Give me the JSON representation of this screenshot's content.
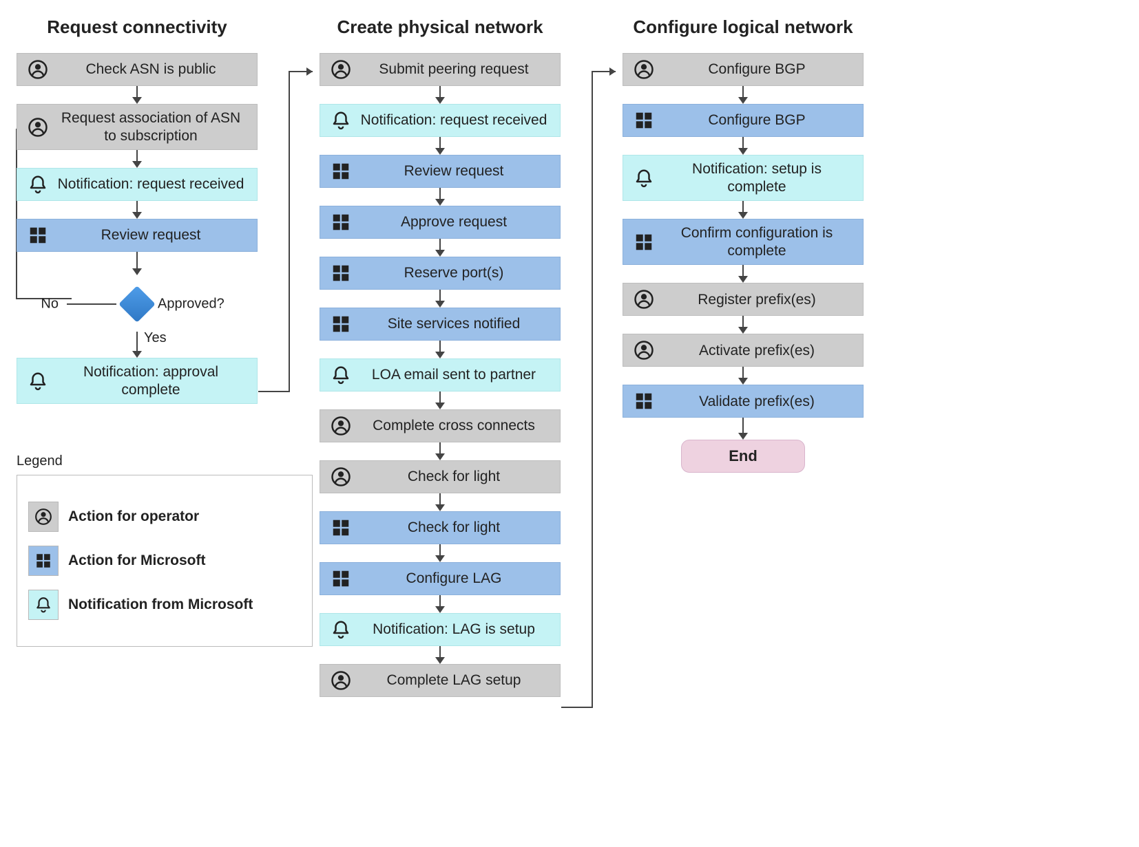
{
  "columns": {
    "c1": {
      "title": "Request connectivity",
      "steps": [
        {
          "label": "Check ASN is public"
        },
        {
          "label": "Request association of ASN to subscription"
        },
        {
          "label": "Notification: request received"
        },
        {
          "label": "Review request"
        },
        {
          "label": "Notification: approval complete"
        }
      ],
      "decision": {
        "no": "No",
        "yes": "Yes",
        "question": "Approved?"
      }
    },
    "c2": {
      "title": "Create physical network",
      "steps": [
        {
          "label": "Submit peering request"
        },
        {
          "label": "Notification: request received"
        },
        {
          "label": "Review request"
        },
        {
          "label": "Approve request"
        },
        {
          "label": "Reserve port(s)"
        },
        {
          "label": "Site services notified"
        },
        {
          "label": "LOA email sent to partner"
        },
        {
          "label": "Complete cross connects"
        },
        {
          "label": "Check for light"
        },
        {
          "label": "Check for light"
        },
        {
          "label": "Configure LAG"
        },
        {
          "label": "Notification: LAG is setup"
        },
        {
          "label": "Complete LAG setup"
        }
      ]
    },
    "c3": {
      "title": "Configure logical network",
      "steps": [
        {
          "label": "Configure BGP"
        },
        {
          "label": "Configure BGP"
        },
        {
          "label": "Notification: setup is complete"
        },
        {
          "label": "Confirm configuration is complete"
        },
        {
          "label": "Register prefix(es)"
        },
        {
          "label": "Activate prefix(es)"
        },
        {
          "label": "Validate prefix(es)"
        }
      ],
      "end": "End"
    }
  },
  "legend": {
    "title": "Legend",
    "items": [
      {
        "label": "Action for operator"
      },
      {
        "label": "Action for Microsoft"
      },
      {
        "label": "Notification from Microsoft"
      }
    ]
  }
}
